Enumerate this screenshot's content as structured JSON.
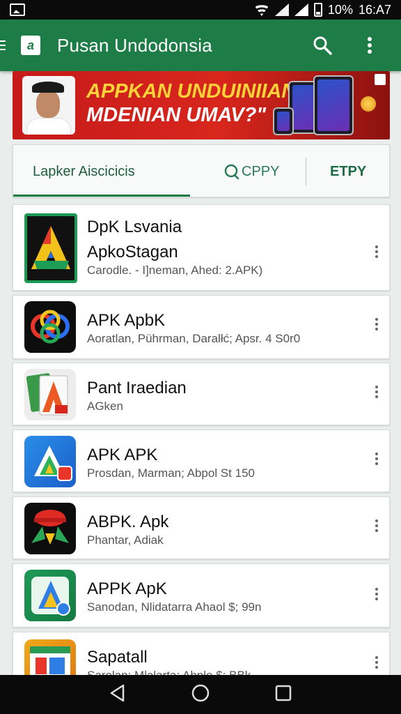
{
  "status_bar": {
    "battery": "10%",
    "time": "16:A7"
  },
  "app_bar": {
    "logo_letter": "a",
    "title": "Pusan Undodonsia"
  },
  "banner": {
    "line1": "APPKAN UNDUINIIAN",
    "line2": "MDENIAN UMAV?\""
  },
  "tabs": [
    {
      "label": "Lapker  Aiscicicis"
    },
    {
      "label": "CPPY"
    },
    {
      "label": "ETPY"
    }
  ],
  "apps": [
    {
      "name_line1": "DpK Lsvania",
      "name_line2": "ApkoStagan",
      "meta": "Carodle. - I]neman, Ahed: 2.APK)"
    },
    {
      "name_line1": "APK ApbK",
      "meta": "Aoratlan, Pührman, Daralłć; Apsr. 4 S0r0"
    },
    {
      "name_line1": "Pant Iraedian",
      "meta": "AGken"
    },
    {
      "name_line1": "APK APK",
      "meta": "Prosdan, Marman; Abpol St 150"
    },
    {
      "name_line1": "ABPK. Apk",
      "meta": "Phantar, Adiak"
    },
    {
      "name_line1": "APPK ApK",
      "meta": "Sanodan, Nlidatarra Ahaol $; 99n"
    },
    {
      "name_line1": "Sapatall",
      "meta": "Sarolan; Mlalarta; Abple $; BBk"
    }
  ],
  "colors": {
    "primary": "#1e7d46",
    "banner_red": "#d8261c",
    "banner_yellow": "#ffd23a"
  }
}
